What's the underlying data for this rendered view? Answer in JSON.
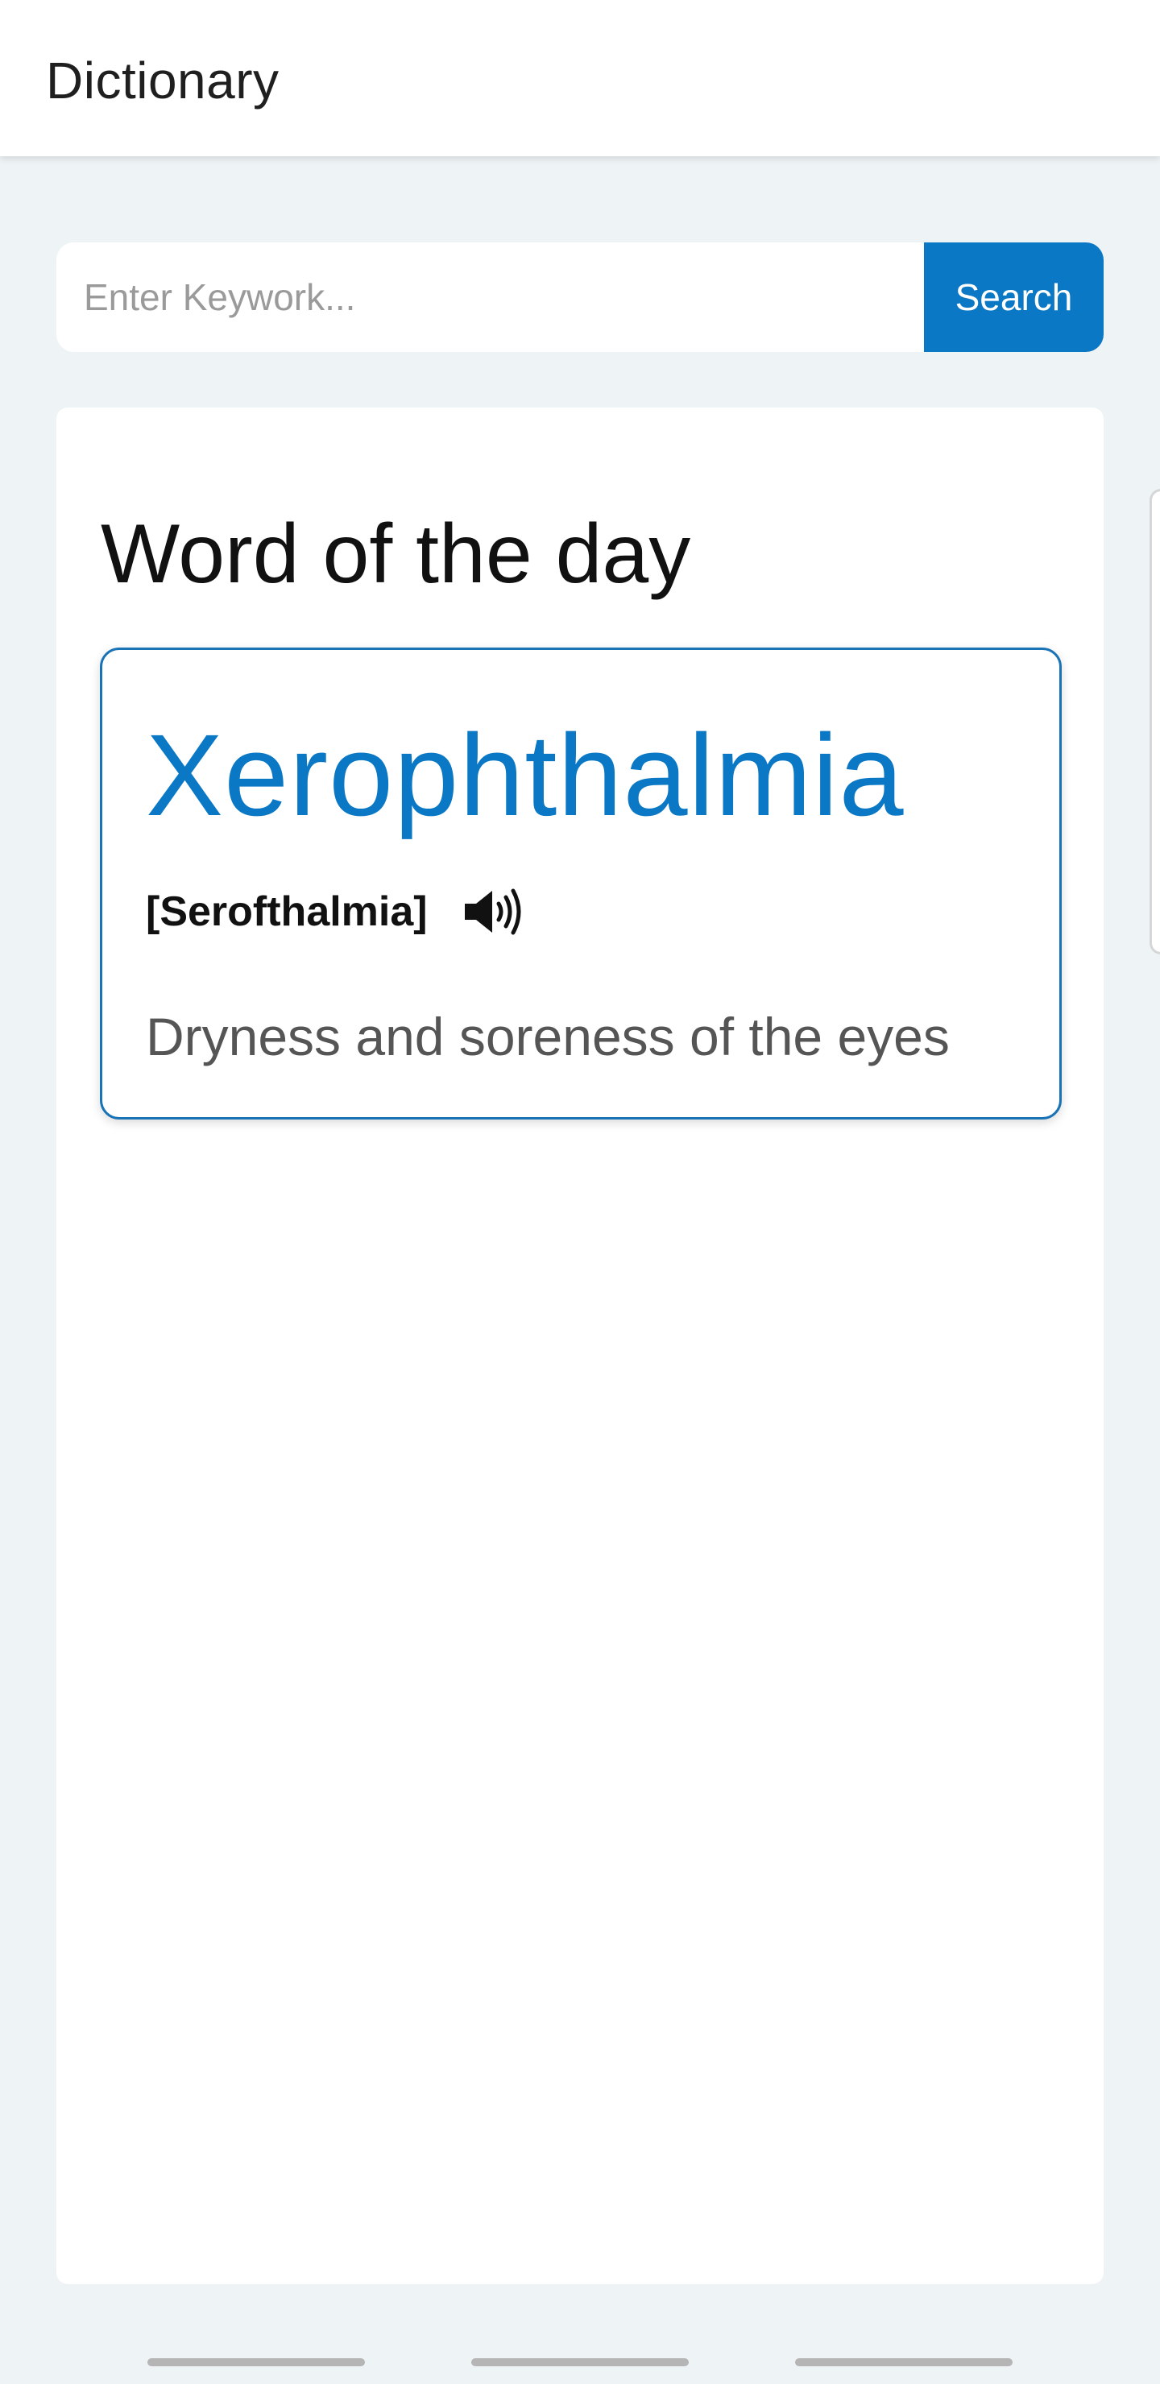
{
  "app": {
    "title": "Dictionary"
  },
  "search": {
    "placeholder": "Enter Keywork...",
    "value": "",
    "button_label": "Search"
  },
  "word_of_the_day": {
    "heading": "Word of the day",
    "word": "Xerophthalmia",
    "phonetic": "[Serofthalmia]",
    "definition": "Dryness and soreness of the eyes"
  },
  "icons": {
    "speaker": "speaker-icon"
  },
  "colors": {
    "accent": "#0a78c5",
    "card_border": "#1a73b5",
    "background": "#eef3f5",
    "definition_text": "#555555"
  }
}
